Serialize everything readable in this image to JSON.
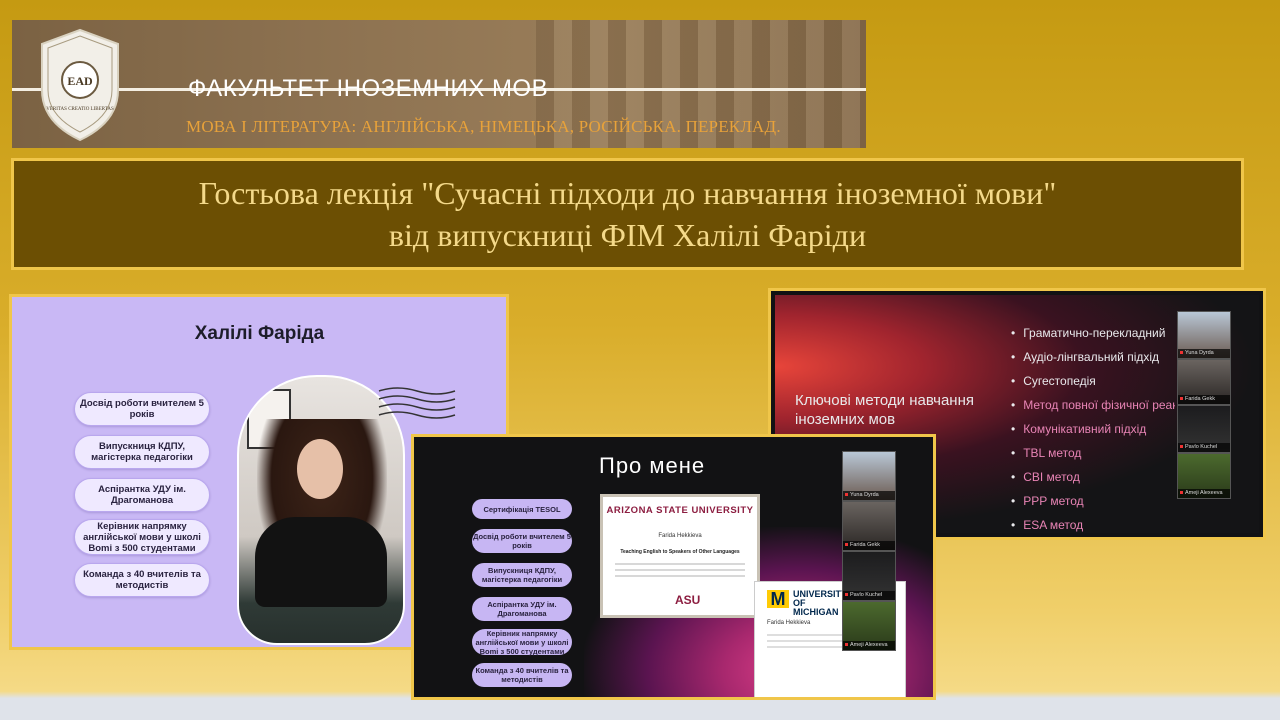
{
  "header": {
    "faculty": "ФАКУЛЬТЕТ ІНОЗЕМНИХ МОВ",
    "subtitle": "МОВА І ЛІТЕРАТУРА: АНГЛІЙСЬКА, НІМЕЦЬКА, РОСІЙСЬКА. ПЕРЕКЛАД.",
    "logo_text": "EAD",
    "logo_motto": "VERITAS CREATIO LIBERTAS"
  },
  "lecture": {
    "line1": "Гостьова лекція \"Сучасні підходи до навчання іноземної мови\"",
    "line2": "від випускниці ФІМ Халілі Фаріди"
  },
  "slide1": {
    "name": "Халілі Фаріда",
    "items": [
      "Досвід роботи вчителем 5 років",
      "Випускниця КДПУ, магістерка педагогіки",
      "Аспірантка УДУ ім. Драгоманова",
      "Керівник напрямку англійської мови у школі Bomi з 500 студентами",
      "Команда з 40 вчителів та методистів"
    ]
  },
  "slide2": {
    "title": "Про мене",
    "items": [
      "Сертифікація TESOL",
      "Досвід роботи вчителем 5 років",
      "Випускниця КДПУ, магістерка педагогіки",
      "Аспірантка УДУ ім. Драгоманова",
      "Керівник напрямку англійської мови у школі Bomi з 500 студентами",
      "Команда з 40 вчителів та методистів"
    ],
    "cert1_header": "ARIZONA STATE UNIVERSITY",
    "cert1_name": "Farida Hekkieva",
    "cert1_course": "Teaching English to Speakers of Other Languages",
    "cert1_logo": "ASU",
    "cert2_university": "UNIVERSITY OF MICHIGAN",
    "cert2_name": "Farida Hekkieva",
    "participants": [
      "Yuna Dyrda",
      "Farida Gekk",
      "Pavlo Kuchel",
      "Ameji Alexeeva"
    ]
  },
  "slide3": {
    "heading": "Ключові методи навчання іноземних мов",
    "methods": [
      {
        "text": "Граматично-перекладний",
        "highlight": false
      },
      {
        "text": "Аудіо-лінгвальний підхід",
        "highlight": false
      },
      {
        "text": "Сугестопедія",
        "highlight": false
      },
      {
        "text": "Метод повної фізичної реакції",
        "highlight": true
      },
      {
        "text": "Комунікативний підхід",
        "highlight": true
      },
      {
        "text": "TBL метод",
        "highlight": true
      },
      {
        "text": "CBI метод",
        "highlight": true
      },
      {
        "text": "PPP метод",
        "highlight": true
      },
      {
        "text": "ESA метод",
        "highlight": true
      }
    ],
    "participants": [
      "Yuna Dyrda",
      "Farida Gekk",
      "Pavlo Kuchel",
      "Ameji Alexeeva"
    ]
  },
  "colors": {
    "background": "#d9ad2a",
    "title_box": "#6c4f03",
    "title_text": "#f4d98a",
    "frame": "#f0c64a",
    "lavender": "#c9b8f5",
    "highlight_pink": "#e884b5"
  }
}
